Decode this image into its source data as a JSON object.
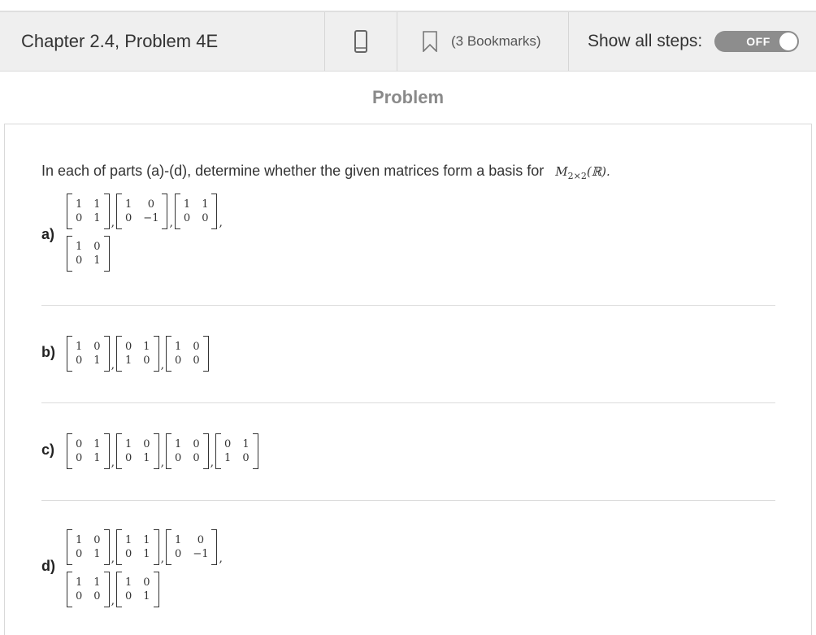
{
  "header": {
    "title": "Chapter 2.4, Problem 4E",
    "bookmarks": "(3 Bookmarks)",
    "show_steps_label": "Show all steps:",
    "toggle_state": "OFF"
  },
  "section_title": "Problem",
  "problem": {
    "intro": "In each of parts (a)-(d), determine whether the given matrices form a basis for",
    "space_symbol": "M",
    "space_sub": "2×2",
    "space_field": "(ℝ)."
  },
  "parts": [
    {
      "label": "a)",
      "matrices": [
        [
          [
            "1",
            "1"
          ],
          [
            "0",
            "1"
          ]
        ],
        [
          [
            "1",
            "0"
          ],
          [
            "0",
            "−1"
          ]
        ],
        [
          [
            "1",
            "1"
          ],
          [
            "0",
            "0"
          ]
        ],
        [
          [
            "1",
            "0"
          ],
          [
            "0",
            "1"
          ]
        ]
      ]
    },
    {
      "label": "b)",
      "matrices": [
        [
          [
            "1",
            "0"
          ],
          [
            "0",
            "1"
          ]
        ],
        [
          [
            "0",
            "1"
          ],
          [
            "1",
            "0"
          ]
        ],
        [
          [
            "1",
            "0"
          ],
          [
            "0",
            "0"
          ]
        ]
      ]
    },
    {
      "label": "c)",
      "matrices": [
        [
          [
            "0",
            "1"
          ],
          [
            "0",
            "1"
          ]
        ],
        [
          [
            "1",
            "0"
          ],
          [
            "0",
            "1"
          ]
        ],
        [
          [
            "1",
            "0"
          ],
          [
            "0",
            "0"
          ]
        ],
        [
          [
            "0",
            "1"
          ],
          [
            "1",
            "0"
          ]
        ]
      ]
    },
    {
      "label": "d)",
      "matrices": [
        [
          [
            "1",
            "0"
          ],
          [
            "0",
            "1"
          ]
        ],
        [
          [
            "1",
            "1"
          ],
          [
            "0",
            "1"
          ]
        ],
        [
          [
            "1",
            "0"
          ],
          [
            "0",
            "−1"
          ]
        ],
        [
          [
            "1",
            "1"
          ],
          [
            "0",
            "0"
          ]
        ],
        [
          [
            "1",
            "0"
          ],
          [
            "0",
            "1"
          ]
        ]
      ]
    }
  ]
}
